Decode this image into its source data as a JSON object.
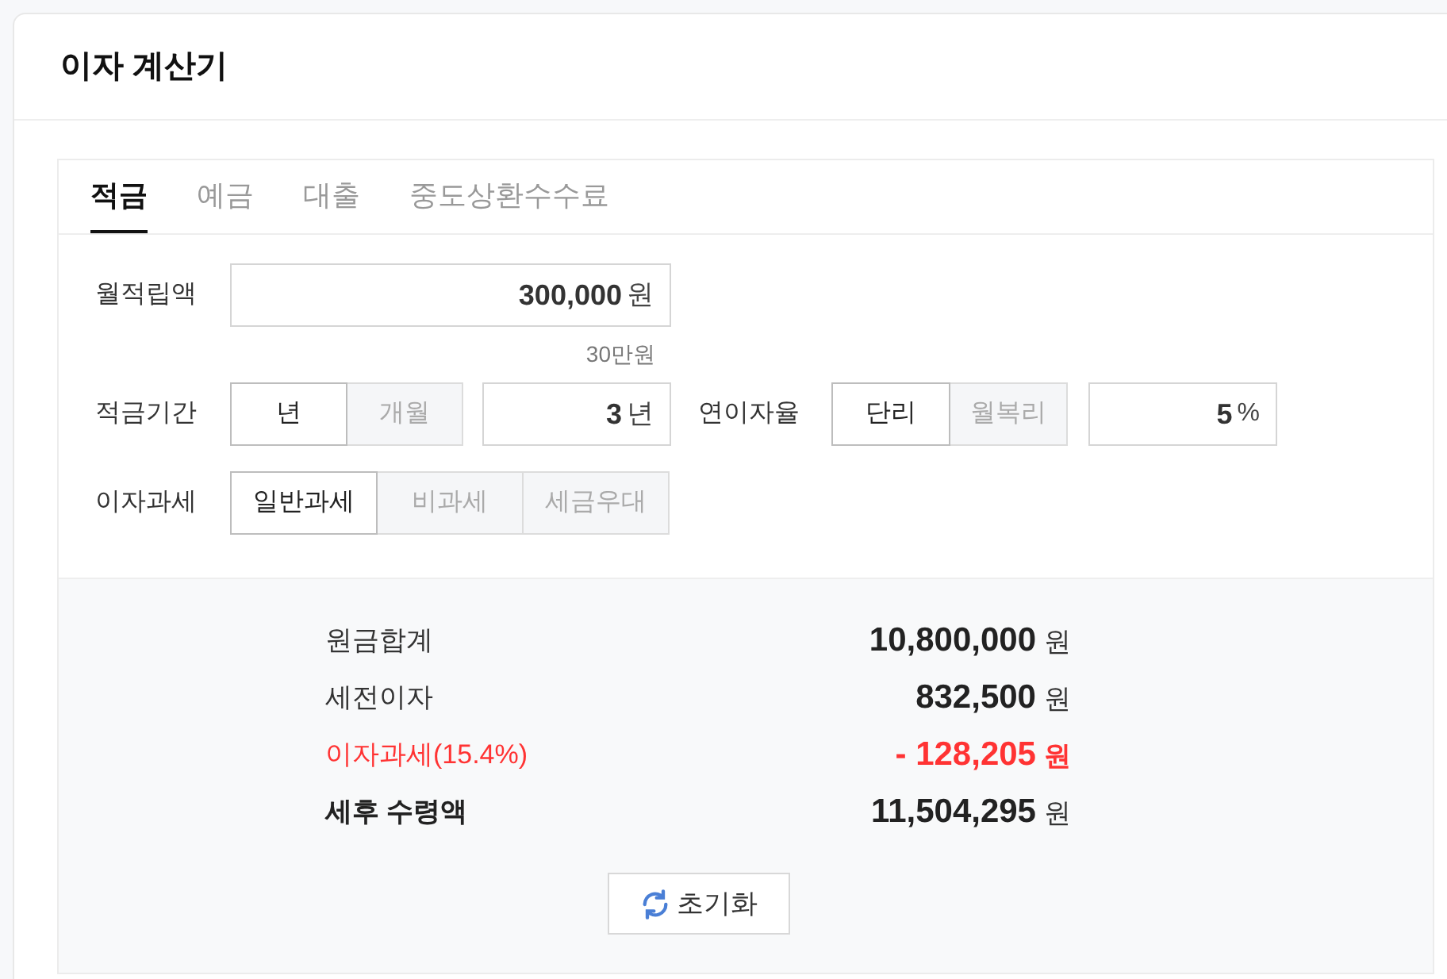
{
  "title": "이자 계산기",
  "tabs": [
    {
      "label": "적금",
      "selected": true
    },
    {
      "label": "예금",
      "selected": false
    },
    {
      "label": "대출",
      "selected": false
    },
    {
      "label": "중도상환수수료",
      "selected": false
    }
  ],
  "monthly": {
    "label": "월적립액",
    "value": "300,000",
    "unit": "원",
    "hint": "30만원"
  },
  "period": {
    "label": "적금기간",
    "options": [
      {
        "label": "년",
        "selected": true
      },
      {
        "label": "개월",
        "selected": false
      }
    ],
    "value": "3",
    "unit": "년"
  },
  "rate": {
    "label": "연이자율",
    "options": [
      {
        "label": "단리",
        "selected": true
      },
      {
        "label": "월복리",
        "selected": false
      }
    ],
    "value": "5",
    "unit": "%"
  },
  "tax": {
    "label": "이자과세",
    "options": [
      {
        "label": "일반과세",
        "selected": true
      },
      {
        "label": "비과세",
        "selected": false
      },
      {
        "label": "세금우대",
        "selected": false
      }
    ]
  },
  "results": [
    {
      "kind": "normal",
      "label": "원금합계",
      "value": "10,800,000",
      "unit": "원"
    },
    {
      "kind": "normal",
      "label": "세전이자",
      "value": "832,500",
      "unit": "원"
    },
    {
      "kind": "tax",
      "label": "이자과세(15.4%)",
      "value": "- 128,205",
      "unit": "원"
    },
    {
      "kind": "total",
      "label": "세후 수령액",
      "value": "11,504,295",
      "unit": "원"
    }
  ],
  "reset_button": "초기화"
}
